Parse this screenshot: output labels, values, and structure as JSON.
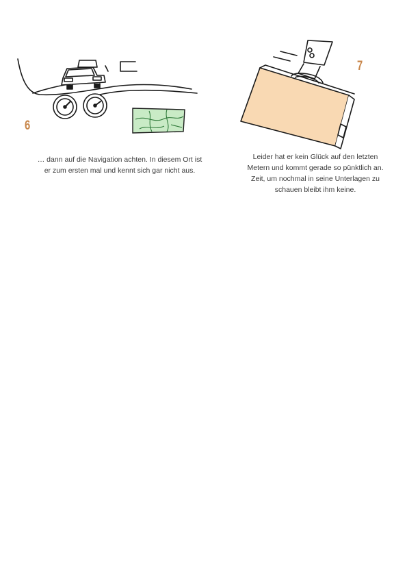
{
  "panels": [
    {
      "number": "6",
      "caption_line1": "… dann auf die Navigation achten. In diesem Ort ist",
      "caption_line2": "er zum ersten mal und kennt sich gar nicht aus."
    },
    {
      "number": "7",
      "caption_line1": "Leider hat er kein Glück auf den letzten",
      "caption_line2": "Metern und kommt gerade so pünktlich an.",
      "caption_line3": "Zeit, um nochmal in seine Unterlagen zu",
      "caption_line4": "schauen bleibt ihm keine."
    }
  ],
  "colors": {
    "panel_number": "#c8864a",
    "map_fill": "#c9ebc6",
    "map_lines": "#2f7a3a",
    "briefcase_fill": "#f9d9b3",
    "ink": "#1a1a1a"
  }
}
